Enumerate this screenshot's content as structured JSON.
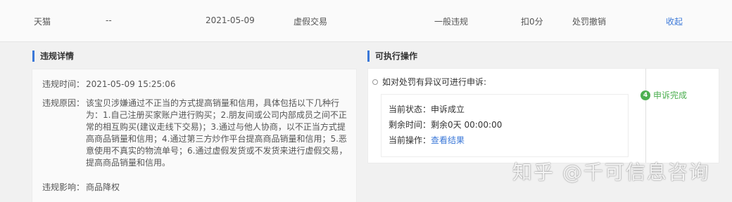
{
  "top_row": {
    "platform": "天猫",
    "dash": "--",
    "date": "2021-05-09",
    "type": "虚假交易",
    "level": "一般违规",
    "points": "扣0分",
    "status": "处罚撤销",
    "action": "收起"
  },
  "details": {
    "title": "违规详情",
    "time_label": "违规时间：",
    "time_value": "2021-05-09 15:25:06",
    "reason_label": "违规原因：",
    "reason_value": "该宝贝涉嫌通过不正当的方式提高销量和信用，具体包括以下几种行为：1.自己注册买家账户进行购买；2.朋友间或公司内部成员之间不正常的相互购买(建议走线下交易)；3.通过与他人协商，以不正当方式提高商品销量和信用；4.通过第三方炒作平台提高商品销量和信用；5.恶意使用不真实的物流单号；6.通过虚假发货或不发货来进行虚假交易，提高商品销量和信用。",
    "impact_label": "违规影响：",
    "impact_value": "商品降权"
  },
  "actions": {
    "title": "可执行操作",
    "appeal_prompt": "如对处罚有异议可进行申诉:",
    "status_label": "当前状态：",
    "status_value": "申诉成立",
    "remaining_label": "剩余时间：",
    "remaining_value": "剩余0天 00:00:00",
    "operation_label": "当前操作：",
    "operation_value": "查看结果",
    "step_number": "4",
    "step_label": "申诉完成"
  },
  "watermark": "知乎 @千可信息咨询"
}
